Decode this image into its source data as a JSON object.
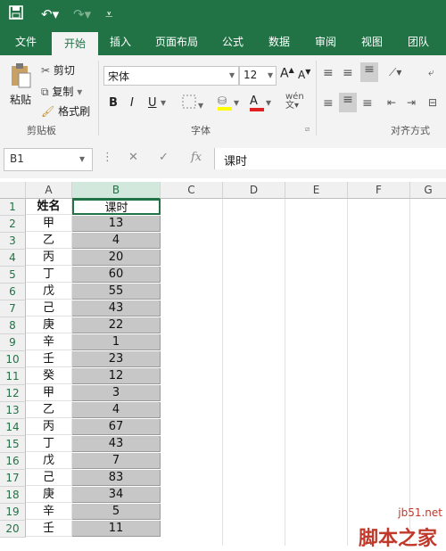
{
  "ribbon_tabs": [
    "文件",
    "开始",
    "插入",
    "页面布局",
    "公式",
    "数据",
    "审阅",
    "视图",
    "团队"
  ],
  "clipboard": {
    "paste": "粘贴",
    "cut": "剪切",
    "copy": "复制",
    "format_painter": "格式刷",
    "group": "剪贴板"
  },
  "font": {
    "name": "宋体",
    "size": "12",
    "bold": "B",
    "italic": "I",
    "underline": "U",
    "color_a": "A",
    "group": "字体"
  },
  "alignment": {
    "group": "对齐方式"
  },
  "formula_bar": {
    "name_box": "B1",
    "fx": "fx",
    "value": "课时"
  },
  "columns": [
    "A",
    "B",
    "C",
    "D",
    "E",
    "F",
    "G"
  ],
  "rows": [
    {
      "n": "1",
      "a": "姓名",
      "b": "课时"
    },
    {
      "n": "2",
      "a": "甲",
      "b": "13"
    },
    {
      "n": "3",
      "a": "乙",
      "b": "4"
    },
    {
      "n": "4",
      "a": "丙",
      "b": "20"
    },
    {
      "n": "5",
      "a": "丁",
      "b": "60"
    },
    {
      "n": "6",
      "a": "戊",
      "b": "55"
    },
    {
      "n": "7",
      "a": "己",
      "b": "43"
    },
    {
      "n": "8",
      "a": "庚",
      "b": "22"
    },
    {
      "n": "9",
      "a": "辛",
      "b": "1"
    },
    {
      "n": "10",
      "a": "壬",
      "b": "23"
    },
    {
      "n": "11",
      "a": "癸",
      "b": "12"
    },
    {
      "n": "12",
      "a": "甲",
      "b": "3"
    },
    {
      "n": "13",
      "a": "乙",
      "b": "4"
    },
    {
      "n": "14",
      "a": "丙",
      "b": "67"
    },
    {
      "n": "15",
      "a": "丁",
      "b": "43"
    },
    {
      "n": "16",
      "a": "戊",
      "b": "7"
    },
    {
      "n": "17",
      "a": "己",
      "b": "83"
    },
    {
      "n": "18",
      "a": "庚",
      "b": "34"
    },
    {
      "n": "19",
      "a": "辛",
      "b": "5"
    },
    {
      "n": "20",
      "a": "壬",
      "b": "11"
    }
  ],
  "watermark": {
    "url": "jb51.net",
    "name": "脚本之家"
  },
  "colors": {
    "accent": "#217346",
    "selection": "#c7c7c7"
  }
}
